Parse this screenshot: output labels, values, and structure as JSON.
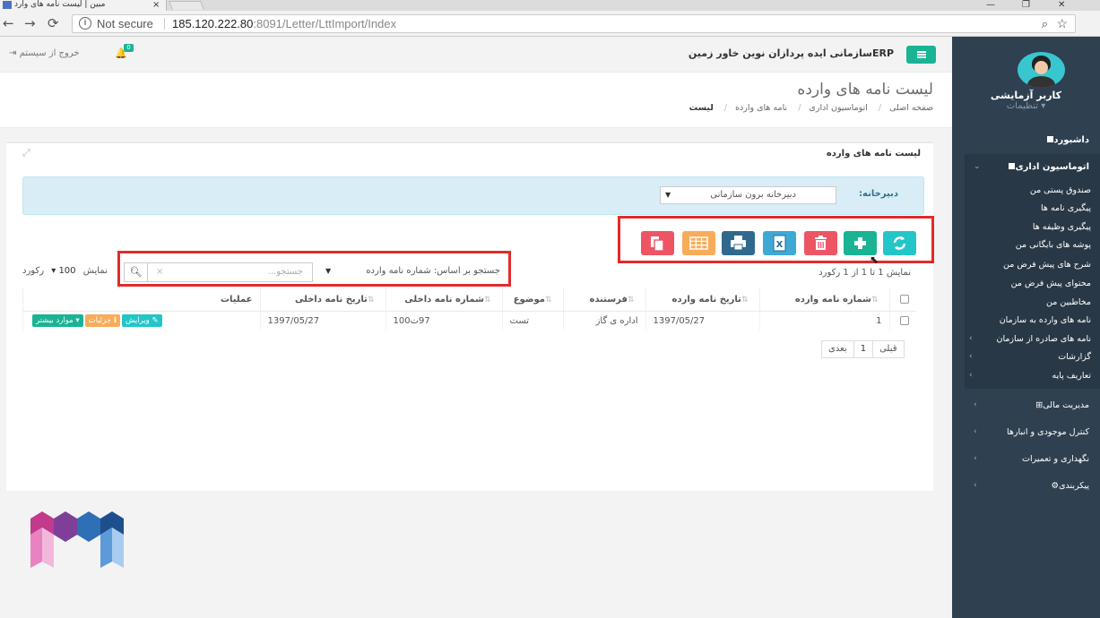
{
  "browser": {
    "tab_title": "مبین | لیست نامه های وارد",
    "tab_close": "×",
    "url_not_secure": "Not secure",
    "url_host": "185.120.222.80",
    "url_rest": ":8091/Letter/LttImport/Index"
  },
  "topbar": {
    "corp_title": "ERPسازمانی ایده پردازان نوین خاور زمین",
    "logout_label": "خروج از سیستم",
    "notification_count": "0"
  },
  "user": {
    "name": "کاربر آزمایشی",
    "settings_label": "تنظیمات"
  },
  "sidebar": {
    "dashboard": "داشبورد",
    "office_automation": "اتوماسیون اداری",
    "sub_items": [
      "صندوق پستی من",
      "پیگیری نامه ها",
      "پیگیری وظیفه ها",
      "پوشه های بایگانی من",
      "شرح های پیش فرض من",
      "محتوای پیش فرض من",
      "مخاطبین من",
      "نامه های وارده به سازمان",
      "نامه های صادره از سازمان",
      "گزارشات",
      "تعاریف پایه"
    ],
    "other_modules": [
      "مدیریت مالی",
      "کنترل موجودی و انبارها",
      "نگهداری و تعمیرات",
      "پیکربندی"
    ]
  },
  "page": {
    "title": "لیست نامه های وارده",
    "breadcrumb": [
      "صفحه اصلی",
      "اتوماسیون اداری",
      "نامه های وارده",
      "لیست"
    ]
  },
  "panel": {
    "title": "لیست نامه های وارده",
    "secretariat_label": "دبیرخانه:",
    "secretariat_value": "دبیرخانه برون سازمانی",
    "search_by_label": "جستجو بر اساس:",
    "search_by_value": "شماره نامه وارده",
    "search_placeholder": "جستجو...",
    "page_size_prefix": "نمایش",
    "page_size_value": "100",
    "page_size_suffix": "رکورد",
    "showing_info": "نمایش 1 تا 1 از 1 رکورد"
  },
  "table": {
    "columns": [
      "شماره نامه وارده",
      "تاریخ نامه وارده",
      "فرستنده",
      "موضوع",
      "شماره نامه داخلی",
      "تاریخ نامه داخلی",
      "عملیات"
    ],
    "rows": [
      {
        "number": "1",
        "date": "1397/05/27",
        "sender": "اداره ی گاز",
        "subject": "تست",
        "internal_no": "97ت100",
        "internal_date": "1397/05/27"
      }
    ],
    "actions": {
      "edit": "ویرایش",
      "details": "جزئیات",
      "more": "موارد بیشتر"
    }
  },
  "pager": {
    "prev": "قبلی",
    "page": "1",
    "next": "بعدی"
  },
  "colors": {
    "sidebar_bg": "#2f4050",
    "accent": "#1ab394",
    "highlight": "#e02b2b",
    "refresh": "#23c6c8",
    "add": "#1ab394",
    "delete": "#ed5565",
    "excel": "#3fa9d6",
    "print": "#2f6a8e",
    "columns": "#f8ac59",
    "copy": "#ed5565"
  },
  "toolbar_icons": [
    "refresh-icon",
    "plus-icon",
    "trash-icon",
    "excel-icon",
    "print-icon",
    "columns-icon",
    "copy-icon"
  ]
}
